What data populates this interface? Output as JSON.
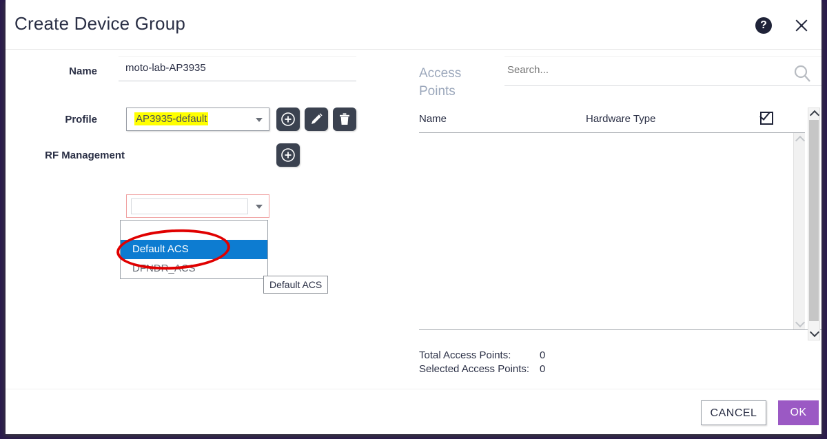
{
  "header": {
    "title": "Create Device Group",
    "help_icon": "question-mark-circle-icon",
    "help_glyph": "?",
    "close_icon": "close-icon"
  },
  "form": {
    "name": {
      "label": "Name",
      "value": "moto-lab-AP3935",
      "placeholder": ""
    },
    "profile": {
      "label": "Profile",
      "value": "AP3935-default",
      "highlight_color": "#ffff00",
      "actions": [
        {
          "name": "add-profile-button",
          "icon": "plus-circle-icon"
        },
        {
          "name": "edit-profile-button",
          "icon": "pencil-icon"
        },
        {
          "name": "delete-profile-button",
          "icon": "trash-icon"
        }
      ]
    },
    "rf_management": {
      "label": "RF Management",
      "value": "",
      "invalid": true,
      "invalid_border_color": "#f0a0a0",
      "add_button_icon": "plus-circle-icon",
      "dropdown": {
        "options": [
          {
            "label": "",
            "selected": false
          },
          {
            "label": "Default ACS",
            "selected": true
          },
          {
            "label": "DFNDR_ACS",
            "selected": false
          }
        ],
        "selected_background": "#0d7cd1"
      },
      "tooltip": "Default ACS"
    }
  },
  "access_points": {
    "panel_label": "Access Points",
    "search": {
      "value": "",
      "placeholder": "Search...",
      "icon": "search-icon"
    },
    "table": {
      "columns": [
        "Name",
        "Hardware Type"
      ],
      "select_all_checkbox": {
        "name": "select-all-checkbox",
        "checked": true
      },
      "rows": []
    },
    "counts": {
      "total_label": "Total Access Points:",
      "total_value": "0",
      "selected_label": "Selected Access Points:",
      "selected_value": "0"
    }
  },
  "footer": {
    "cancel_label": "CANCEL",
    "ok_label": "OK",
    "ok_color": "#9b59c4"
  },
  "annotations": {
    "red_circle_color": "#e00000",
    "highlight_target": "AP3935-default",
    "circle_target": "Default ACS"
  }
}
